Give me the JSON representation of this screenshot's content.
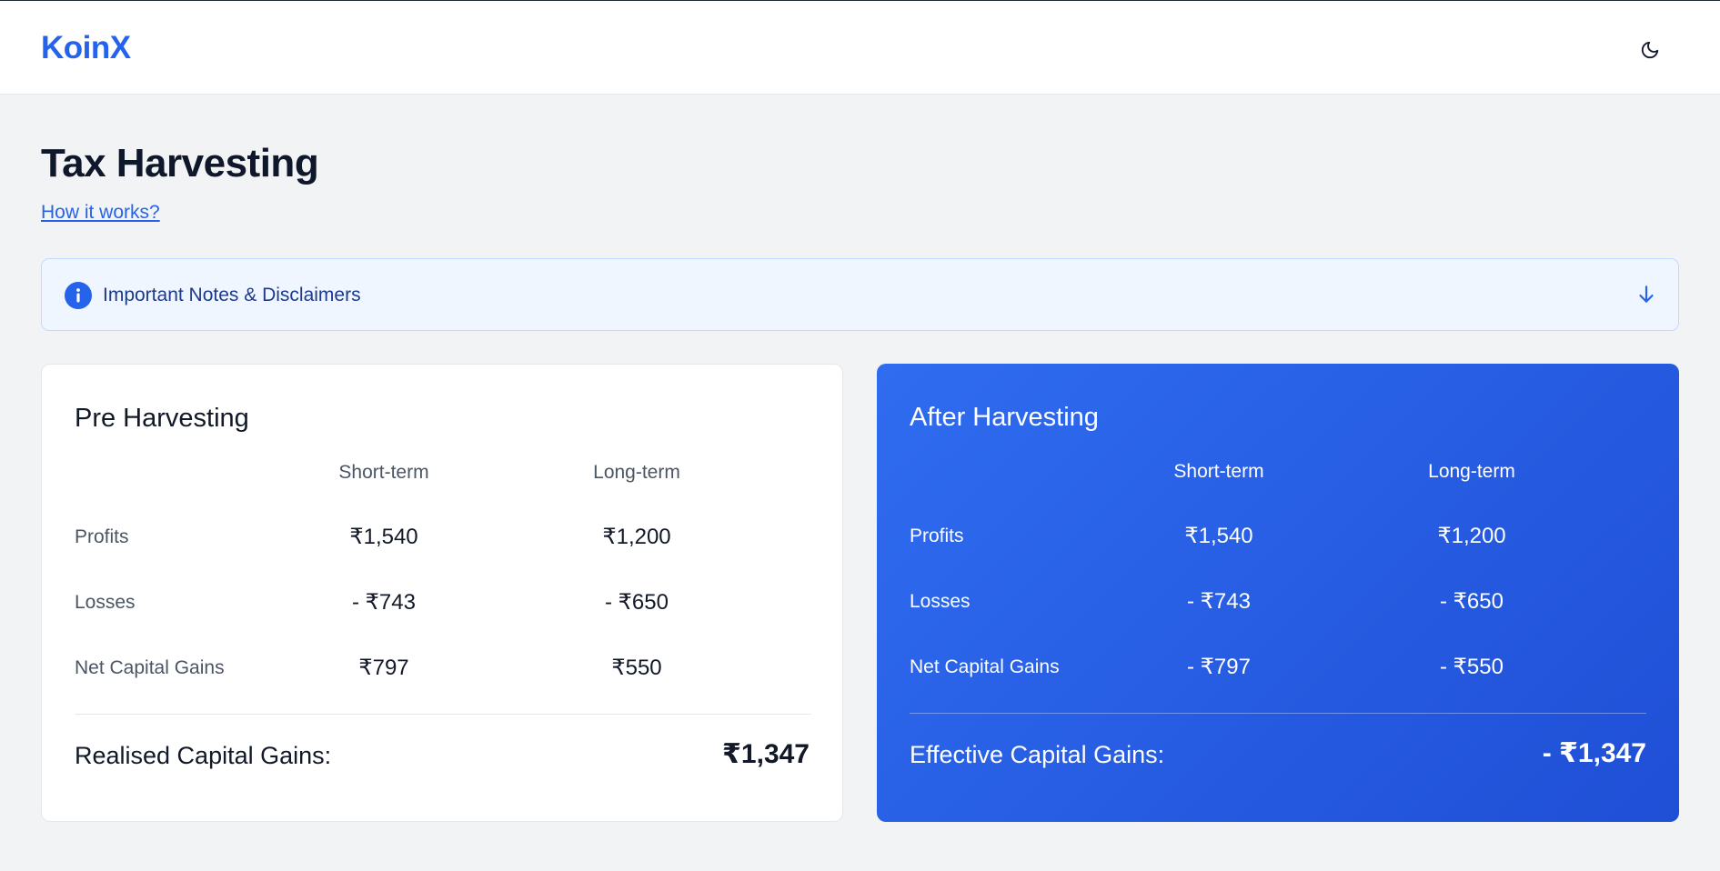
{
  "header": {
    "logo": "KoinX",
    "theme_toggle_icon": "moon-icon"
  },
  "page": {
    "title": "Tax Harvesting",
    "how_link": "How it works?"
  },
  "notes": {
    "label": "Important Notes & Disclaimers",
    "icon": "info-icon",
    "expand_icon": "arrow-down-icon"
  },
  "columns": {
    "short": "Short-term",
    "long": "Long-term"
  },
  "rows": {
    "profits": "Profits",
    "losses": "Losses",
    "net": "Net Capital Gains"
  },
  "pre": {
    "title": "Pre Harvesting",
    "profits_short": "₹1,540",
    "profits_long": "₹1,200",
    "losses_short": "- ₹743",
    "losses_long": "- ₹650",
    "net_short": "₹797",
    "net_long": "₹550",
    "total_label": "Realised Capital Gains:",
    "total_value": "₹1,347"
  },
  "after": {
    "title": "After Harvesting",
    "profits_short": "₹1,540",
    "profits_long": "₹1,200",
    "losses_short": "- ₹743",
    "losses_long": "- ₹650",
    "net_short": "- ₹797",
    "net_long": "- ₹550",
    "total_label": "Effective Capital Gains:",
    "total_value": "- ₹1,347"
  },
  "colors": {
    "accent": "#2563eb",
    "after_card_bg": "#2563eb",
    "notes_bg": "#eff6ff",
    "page_bg": "#f2f3f5"
  }
}
